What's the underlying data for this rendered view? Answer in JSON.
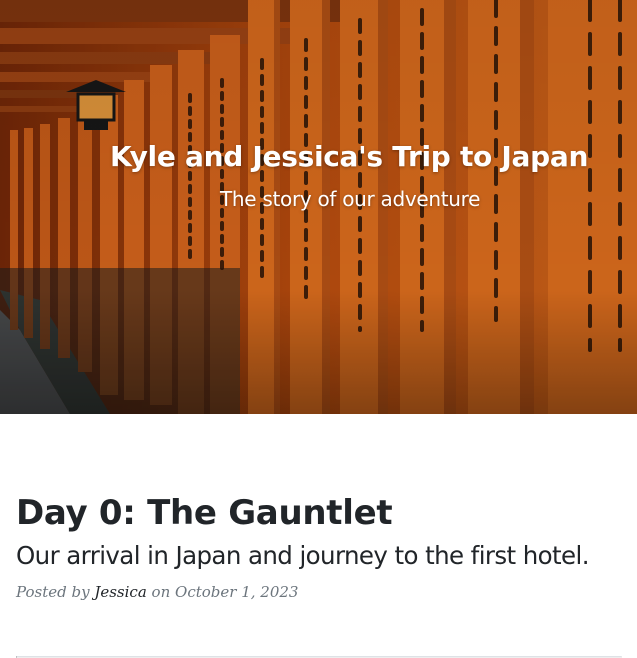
{
  "header": {
    "title": "Kyle and Jessica's Trip to Japan",
    "subtitle": "The story of our adventure",
    "background_image": "torii-gates-photo"
  },
  "post": {
    "title": "Day 0: The Gauntlet",
    "subtitle": "Our arrival in Japan and journey to the first hotel.",
    "meta_prefix": "Posted by ",
    "author": "Jessica",
    "meta_date_prefix": " on ",
    "date": "October 1, 2023"
  },
  "colors": {
    "gate_orange": "#e0661c",
    "text_dark": "#212529",
    "meta_gray": "#6c757d"
  }
}
